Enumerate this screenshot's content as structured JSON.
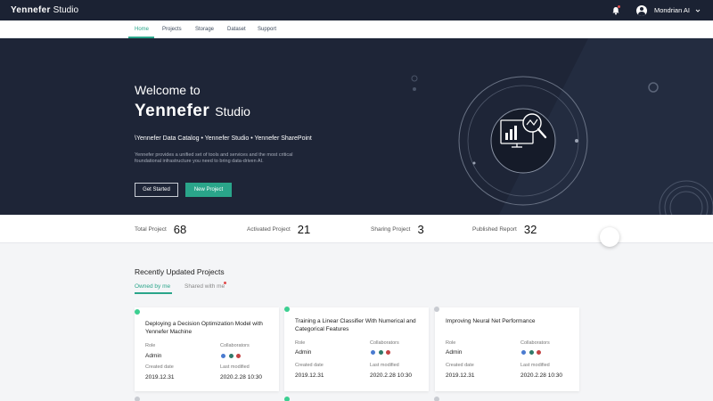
{
  "app": {
    "logo": "Yennefer",
    "name": "Studio"
  },
  "topbar": {
    "icons": [
      "bell-icon",
      "user-avatar-icon",
      "chevron-down-icon"
    ],
    "user_name": "Mondrian AI"
  },
  "nav": {
    "items": [
      "Home",
      "Projects",
      "Storage",
      "Dataset",
      "Support"
    ],
    "active": "Home"
  },
  "hero": {
    "welcome": "Welcome to",
    "brand_logo": "Yennefer",
    "brand_studio": "Studio",
    "products": "\\Yennefer Data Catalog  •  Yennefer Studio  •  Yennefer SharePoint",
    "description": "Yennefer provides a unified set of tools and services and the most critical foundational infrastructure you need to bring data-driven AI.",
    "get_started": "Get Started",
    "new_project": "New Project",
    "illustration_icon": "analytics-magnifier-icon"
  },
  "stats": [
    {
      "label": "Total Project",
      "value": "68"
    },
    {
      "label": "Activated Project",
      "value": "21"
    },
    {
      "label": "Sharing Project",
      "value": "3"
    },
    {
      "label": "Published Report",
      "value": "32"
    }
  ],
  "recent": {
    "title": "Recently Updated Projects",
    "tabs": [
      "Owned by me",
      "Shared with me"
    ]
  },
  "labels": {
    "role": "Role",
    "collaborators": "Collaborators",
    "created": "Created date",
    "modified": "Last modified"
  },
  "cards": [
    {
      "title": "Deploying a Decision Optimization Model with Yennefer Machine",
      "role": "Admin",
      "created": "2019.12.31",
      "modified": "2020.2.28 10:30",
      "status": "active"
    },
    {
      "title": "Training a Linear Classifier With Numerical and Categorical Features",
      "role": "Admin",
      "created": "2019.12.31",
      "modified": "2020.2.28 10:30",
      "status": "active"
    },
    {
      "title": "Improving Neural Net Performance",
      "role": "Admin",
      "created": "2019.12.31",
      "modified": "2020.2.28 10:30",
      "status": "inactive"
    }
  ],
  "colors": {
    "accent": "#2aa58a",
    "hero_bg": "#1e2537",
    "topbar_bg": "#1b2233",
    "active_dot": "#3ccf91",
    "inactive_dot": "#c8cbd1",
    "collaborator_colors": [
      "#4a7bd0",
      "#2f7a6a",
      "#c44545"
    ]
  }
}
